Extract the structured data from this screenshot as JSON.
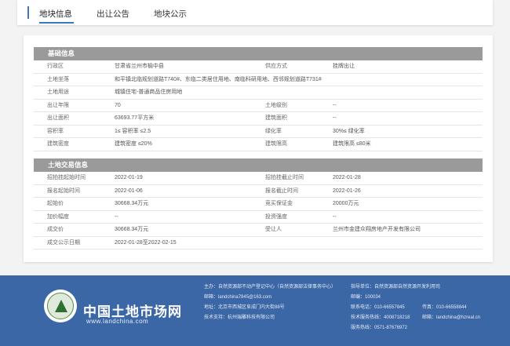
{
  "tabs": [
    {
      "label": "地块信息"
    },
    {
      "label": "出让公告"
    },
    {
      "label": "地块公示"
    }
  ],
  "basic": {
    "title": "基础信息",
    "rows": [
      {
        "l1": "行政区",
        "v1": "甘肃省兰州市榆中县",
        "l2": "供应方式",
        "v2": "挂牌出让"
      },
      {
        "l1": "土地坐落",
        "v1": "和平镇北临规划道路T740#、东临二类居住用地、南临科研用地、西邻规划道路T731#"
      },
      {
        "l1": "土地用途",
        "v1": "城镇住宅-普通商品住房用地"
      },
      {
        "l1": "出让年限",
        "v1": "70",
        "l2": "土地级别",
        "v2": "--"
      },
      {
        "l1": "出让面积",
        "v1": "63693.77平方米",
        "l2": "建筑面积",
        "v2": "--"
      },
      {
        "l1": "容积率",
        "v1": "1≤ 容积率 ≤2.5",
        "l2": "绿化率",
        "v2": "30%≤ 绿化率"
      },
      {
        "l1": "建筑密度",
        "v1": "建筑密度 ≤20%",
        "l2": "建筑限高",
        "v2": "建筑限高 ≤80米"
      }
    ]
  },
  "trade": {
    "title": "土地交易信息",
    "rows": [
      {
        "l1": "招拍挂起始时间",
        "v1": "2022-01-19",
        "l2": "招拍挂截止时间",
        "v2": "2022-01-28"
      },
      {
        "l1": "报名起始时间",
        "v1": "2022-01-06",
        "l2": "报名截止时间",
        "v2": "2022-01-26"
      },
      {
        "l1": "起始价",
        "v1": "30668.34万元",
        "l2": "竞买保证金",
        "v2": "20000万元"
      },
      {
        "l1": "加价幅度",
        "v1": "--",
        "l2": "投资强度",
        "v2": "--"
      },
      {
        "l1": "成交价",
        "v1": "30668.34万元",
        "l2": "受让人",
        "v2": "兰州市金建众翔房地产开发有限公司"
      },
      {
        "l1": "成交公示日期",
        "v1": "2022-01-28至2022-02-15"
      }
    ]
  },
  "footer": {
    "site_name": "中国土地市场网",
    "site_url": "www.landchina.com",
    "sponsor": "主办：自然资源部不动产登记中心（自然资源部法律事务中心）",
    "email": "邮箱：landchina7845@163.com",
    "address": "地址：北京市西城区阜成门内大街88号",
    "tech": "技术支持：杭州瑞雕科技有限公司",
    "guide": "指导单位：自然资源部自然资源开发利用司",
    "postcode": "邮编：100034",
    "phone": "联系电话：010-66557845",
    "fax": "传真：010-66558844",
    "service_hotline": "技术服务热线：4008718218",
    "service_email": "邮箱：landchina@hzreal.cn",
    "service_phone": "服务热线：0571-87676972"
  }
}
